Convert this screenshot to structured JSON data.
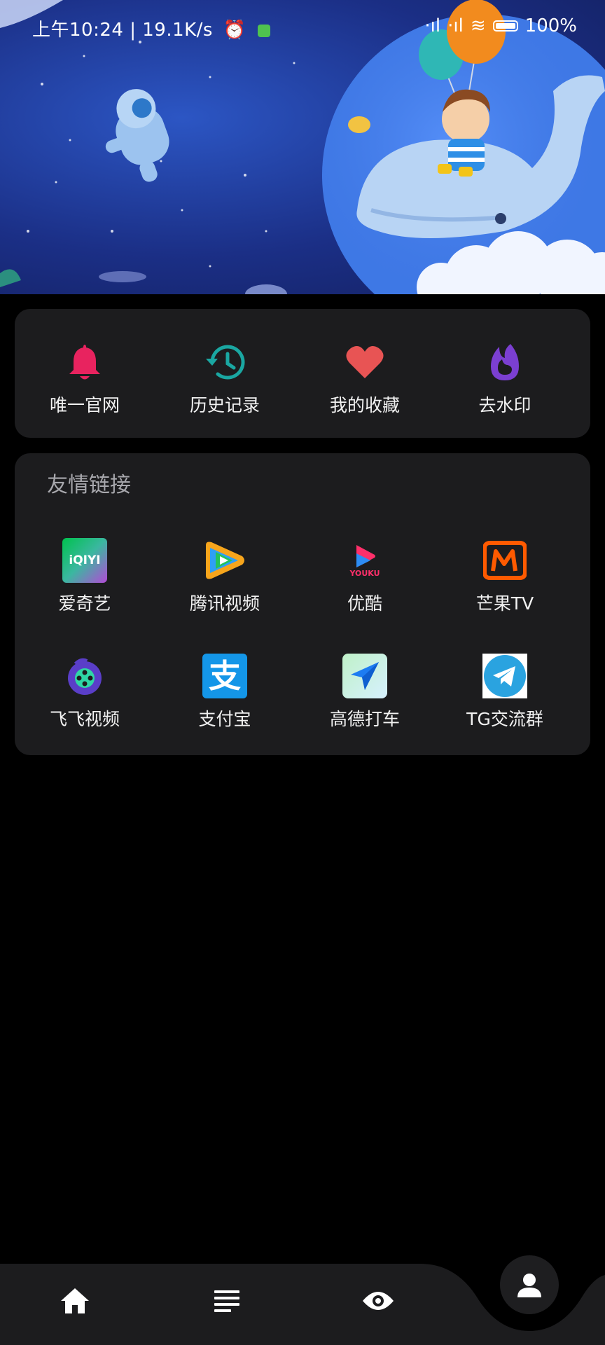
{
  "status_bar": {
    "time": "上午10:24",
    "network_speed": "19.1K/s",
    "battery": "100%"
  },
  "quick_actions": [
    {
      "label": "唯一官网",
      "icon": "bell-icon",
      "color": "#e8235f"
    },
    {
      "label": "历史记录",
      "icon": "history-icon",
      "color": "#1aa7a2"
    },
    {
      "label": "我的收藏",
      "icon": "heart-icon",
      "color": "#e85454"
    },
    {
      "label": "去水印",
      "icon": "flame-icon",
      "color": "#7b3fd1"
    }
  ],
  "friend_links": {
    "title": "友情链接",
    "items": [
      {
        "label": "爱奇艺",
        "icon": "iqiyi-icon",
        "logo_text": "iQIYI"
      },
      {
        "label": "腾讯视频",
        "icon": "tencent-video-icon"
      },
      {
        "label": "优酷",
        "icon": "youku-icon",
        "logo_text": "YOUKU"
      },
      {
        "label": "芒果TV",
        "icon": "mango-tv-icon"
      },
      {
        "label": "飞飞视频",
        "icon": "feifei-video-icon"
      },
      {
        "label": "支付宝",
        "icon": "alipay-icon",
        "logo_text": "支"
      },
      {
        "label": "高德打车",
        "icon": "amap-taxi-icon"
      },
      {
        "label": "TG交流群",
        "icon": "telegram-icon"
      }
    ]
  },
  "bottom_nav": [
    {
      "name": "home",
      "icon": "home-icon"
    },
    {
      "name": "list",
      "icon": "list-icon"
    },
    {
      "name": "watch",
      "icon": "eye-icon"
    },
    {
      "name": "profile",
      "icon": "user-icon",
      "active": true
    }
  ]
}
